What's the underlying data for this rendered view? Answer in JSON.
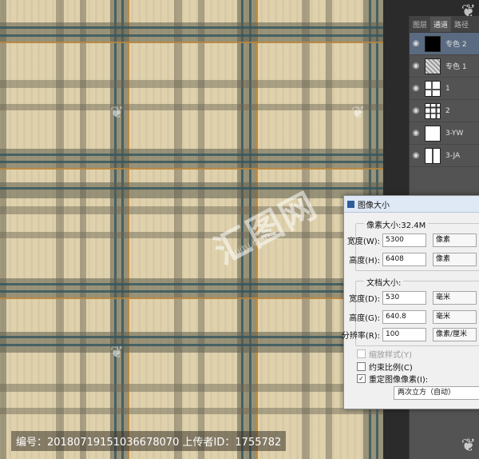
{
  "panel": {
    "tabs": [
      "图层",
      "通道",
      "路径"
    ],
    "channels": [
      {
        "name": "专色 2",
        "visible": true,
        "selected": true
      },
      {
        "name": "专色 1",
        "visible": true,
        "selected": false
      },
      {
        "name": "1",
        "visible": true,
        "selected": false
      },
      {
        "name": "2",
        "visible": true,
        "selected": false
      },
      {
        "name": "3-YW",
        "visible": true,
        "selected": false
      },
      {
        "name": "3-JA",
        "visible": true,
        "selected": false
      }
    ]
  },
  "dialog": {
    "title": "图像大小",
    "pixel_dimensions": {
      "legend": "像素大小:32.4M",
      "width_label": "宽度(W):",
      "width_value": "5300",
      "width_unit": "像素",
      "height_label": "高度(H):",
      "height_value": "6408",
      "height_unit": "像素"
    },
    "document_size": {
      "legend": "文档大小:",
      "width_label": "宽度(D):",
      "width_value": "530",
      "width_unit": "毫米",
      "height_label": "高度(G):",
      "height_value": "640.8",
      "height_unit": "毫米",
      "resolution_label": "分辨率(R):",
      "resolution_value": "100",
      "resolution_unit": "像素/厘米"
    },
    "scale_styles": "缩放样式(Y)",
    "constrain": "约束比例(C)",
    "resample": "重定图像像素(I):",
    "resample_method": "两次立方（自动）"
  },
  "watermark": {
    "footer": "编号：20180719151036678070 上传者ID：1755782",
    "big_logo": "汇图网",
    "url": "huitu.com"
  },
  "colors": {
    "plaid_base": "#ded0aa",
    "stripe_dark": "#6e6a55",
    "stripe_teal": "#3f5f64",
    "stripe_orange": "#c0883a",
    "panel_bg": "#535353",
    "selected_row": "#5a6a80"
  }
}
